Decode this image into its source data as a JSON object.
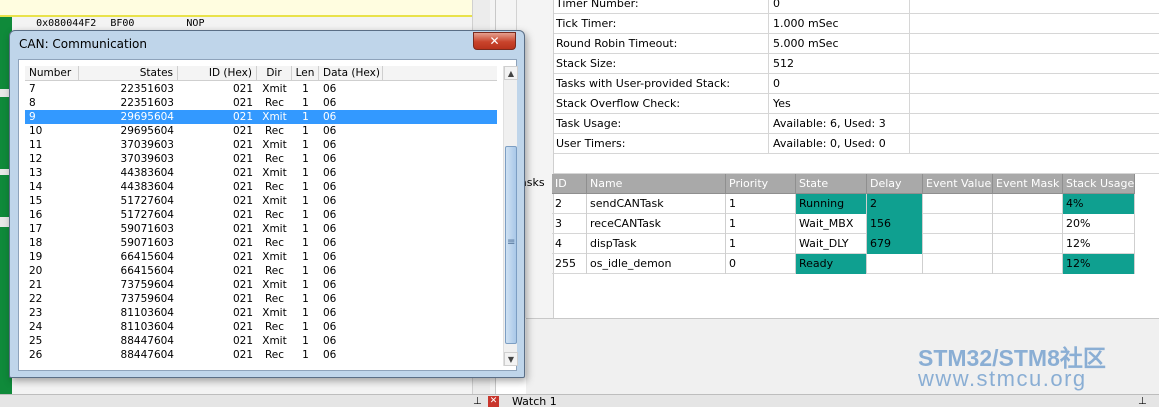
{
  "disasm": {
    "address": "0x080044F2",
    "opcode": "BF00",
    "mnemonic": "NOP"
  },
  "rtx_info": [
    {
      "key": "Timer Number:",
      "value": "0"
    },
    {
      "key": "Tick Timer:",
      "value": "1.000 mSec"
    },
    {
      "key": "Round Robin Timeout:",
      "value": "5.000 mSec"
    },
    {
      "key": "Stack Size:",
      "value": "512"
    },
    {
      "key": "Tasks with User-provided Stack:",
      "value": "0"
    },
    {
      "key": "Stack Overflow Check:",
      "value": "Yes"
    },
    {
      "key": "Task Usage:",
      "value": "Available: 6, Used: 3"
    },
    {
      "key": "User Timers:",
      "value": "Available: 0, Used: 0"
    }
  ],
  "tasks_label": "asks",
  "tasks": {
    "columns": [
      "ID",
      "Name",
      "Priority",
      "State",
      "Delay",
      "Event Value",
      "Event Mask",
      "Stack Usage"
    ],
    "rows": [
      [
        "2",
        "sendCANTask",
        "1",
        "Running",
        "2",
        "",
        "",
        "4%"
      ],
      [
        "3",
        "receCANTask",
        "1",
        "Wait_MBX",
        "156",
        "",
        "",
        "20%"
      ],
      [
        "4",
        "dispTask",
        "1",
        "Wait_DLY",
        "679",
        "",
        "",
        "12%"
      ],
      [
        "255",
        "os_idle_demon",
        "0",
        "Ready",
        "",
        "",
        "",
        "12%"
      ]
    ],
    "highlight_color": "#0fa090"
  },
  "dialog": {
    "title": "CAN: Communication",
    "close_glyph": "✕",
    "columns": [
      "Number",
      "States",
      "ID (Hex)",
      "Dir",
      "Len",
      "Data (Hex)"
    ],
    "selected_index": 2,
    "rows": [
      [
        "7",
        "22351603",
        "021",
        "Xmit",
        "1",
        "06"
      ],
      [
        "8",
        "22351603",
        "021",
        "Rec",
        "1",
        "06"
      ],
      [
        "9",
        "29695604",
        "021",
        "Xmit",
        "1",
        "06"
      ],
      [
        "10",
        "29695604",
        "021",
        "Rec",
        "1",
        "06"
      ],
      [
        "11",
        "37039603",
        "021",
        "Xmit",
        "1",
        "06"
      ],
      [
        "12",
        "37039603",
        "021",
        "Rec",
        "1",
        "06"
      ],
      [
        "13",
        "44383604",
        "021",
        "Xmit",
        "1",
        "06"
      ],
      [
        "14",
        "44383604",
        "021",
        "Rec",
        "1",
        "06"
      ],
      [
        "15",
        "51727604",
        "021",
        "Xmit",
        "1",
        "06"
      ],
      [
        "16",
        "51727604",
        "021",
        "Rec",
        "1",
        "06"
      ],
      [
        "17",
        "59071603",
        "021",
        "Xmit",
        "1",
        "06"
      ],
      [
        "18",
        "59071603",
        "021",
        "Rec",
        "1",
        "06"
      ],
      [
        "19",
        "66415604",
        "021",
        "Xmit",
        "1",
        "06"
      ],
      [
        "20",
        "66415604",
        "021",
        "Rec",
        "1",
        "06"
      ],
      [
        "21",
        "73759604",
        "021",
        "Xmit",
        "1",
        "06"
      ],
      [
        "22",
        "73759604",
        "021",
        "Rec",
        "1",
        "06"
      ],
      [
        "23",
        "81103604",
        "021",
        "Xmit",
        "1",
        "06"
      ],
      [
        "24",
        "81103604",
        "021",
        "Rec",
        "1",
        "06"
      ],
      [
        "25",
        "88447604",
        "021",
        "Xmit",
        "1",
        "06"
      ],
      [
        "26",
        "88447604",
        "021",
        "Rec",
        "1",
        "06"
      ]
    ],
    "selection_color": "#3399ff"
  },
  "bottombar": {
    "watch_label": "Watch 1",
    "pin_glyph": "⊥",
    "close_glyph": "✕"
  },
  "watermark": {
    "brand": "STM32/STM8社区",
    "url": "www.stmcu.org"
  },
  "icons": {
    "scroll_up": "▲",
    "scroll_down": "▼",
    "grip": "≡"
  }
}
